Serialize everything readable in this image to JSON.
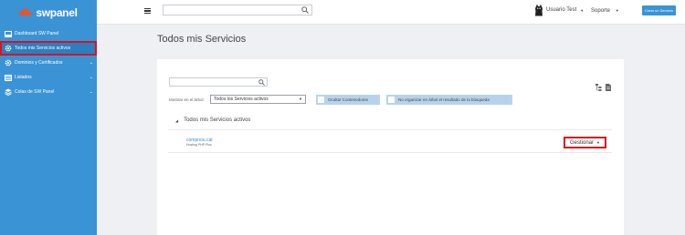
{
  "brand": {
    "name": "swpanel"
  },
  "sidebar": {
    "items": [
      {
        "label": "Dashboard SW Panel",
        "icon": "dashboard-icon"
      },
      {
        "label": "Todos mis Servicios activos",
        "icon": "gear-icon"
      },
      {
        "label": "Dominios y Certificados",
        "icon": "gear-icon"
      },
      {
        "label": "Listados",
        "icon": "list-icon"
      },
      {
        "label": "Colas de SW Panel",
        "icon": "stack-icon"
      }
    ]
  },
  "topbar": {
    "search_value": "",
    "user_name": "Usuario Test",
    "support_label": "Soporte",
    "create_button_label": "Crear un Servicio"
  },
  "main": {
    "title": "Todos mis Servicios",
    "tree_search_value": "",
    "show_label": "Mostrar en el árbol:",
    "show_select_value": "Todos los Servicios activos",
    "toggle_containers_label": "Ocultar Contenedores",
    "toggle_search_label": "No organizar en árbol el resultado de la búsqueda",
    "tree_header": "Todos mis Servicios activos",
    "service": {
      "domain": "compnou.cat",
      "type": "Hosting PHP Plus",
      "manage_label": "Gestionar"
    }
  },
  "colors": {
    "sidebar_bg": "#3a93d5",
    "accent": "#3a93d5",
    "highlight": "#d9131e"
  }
}
